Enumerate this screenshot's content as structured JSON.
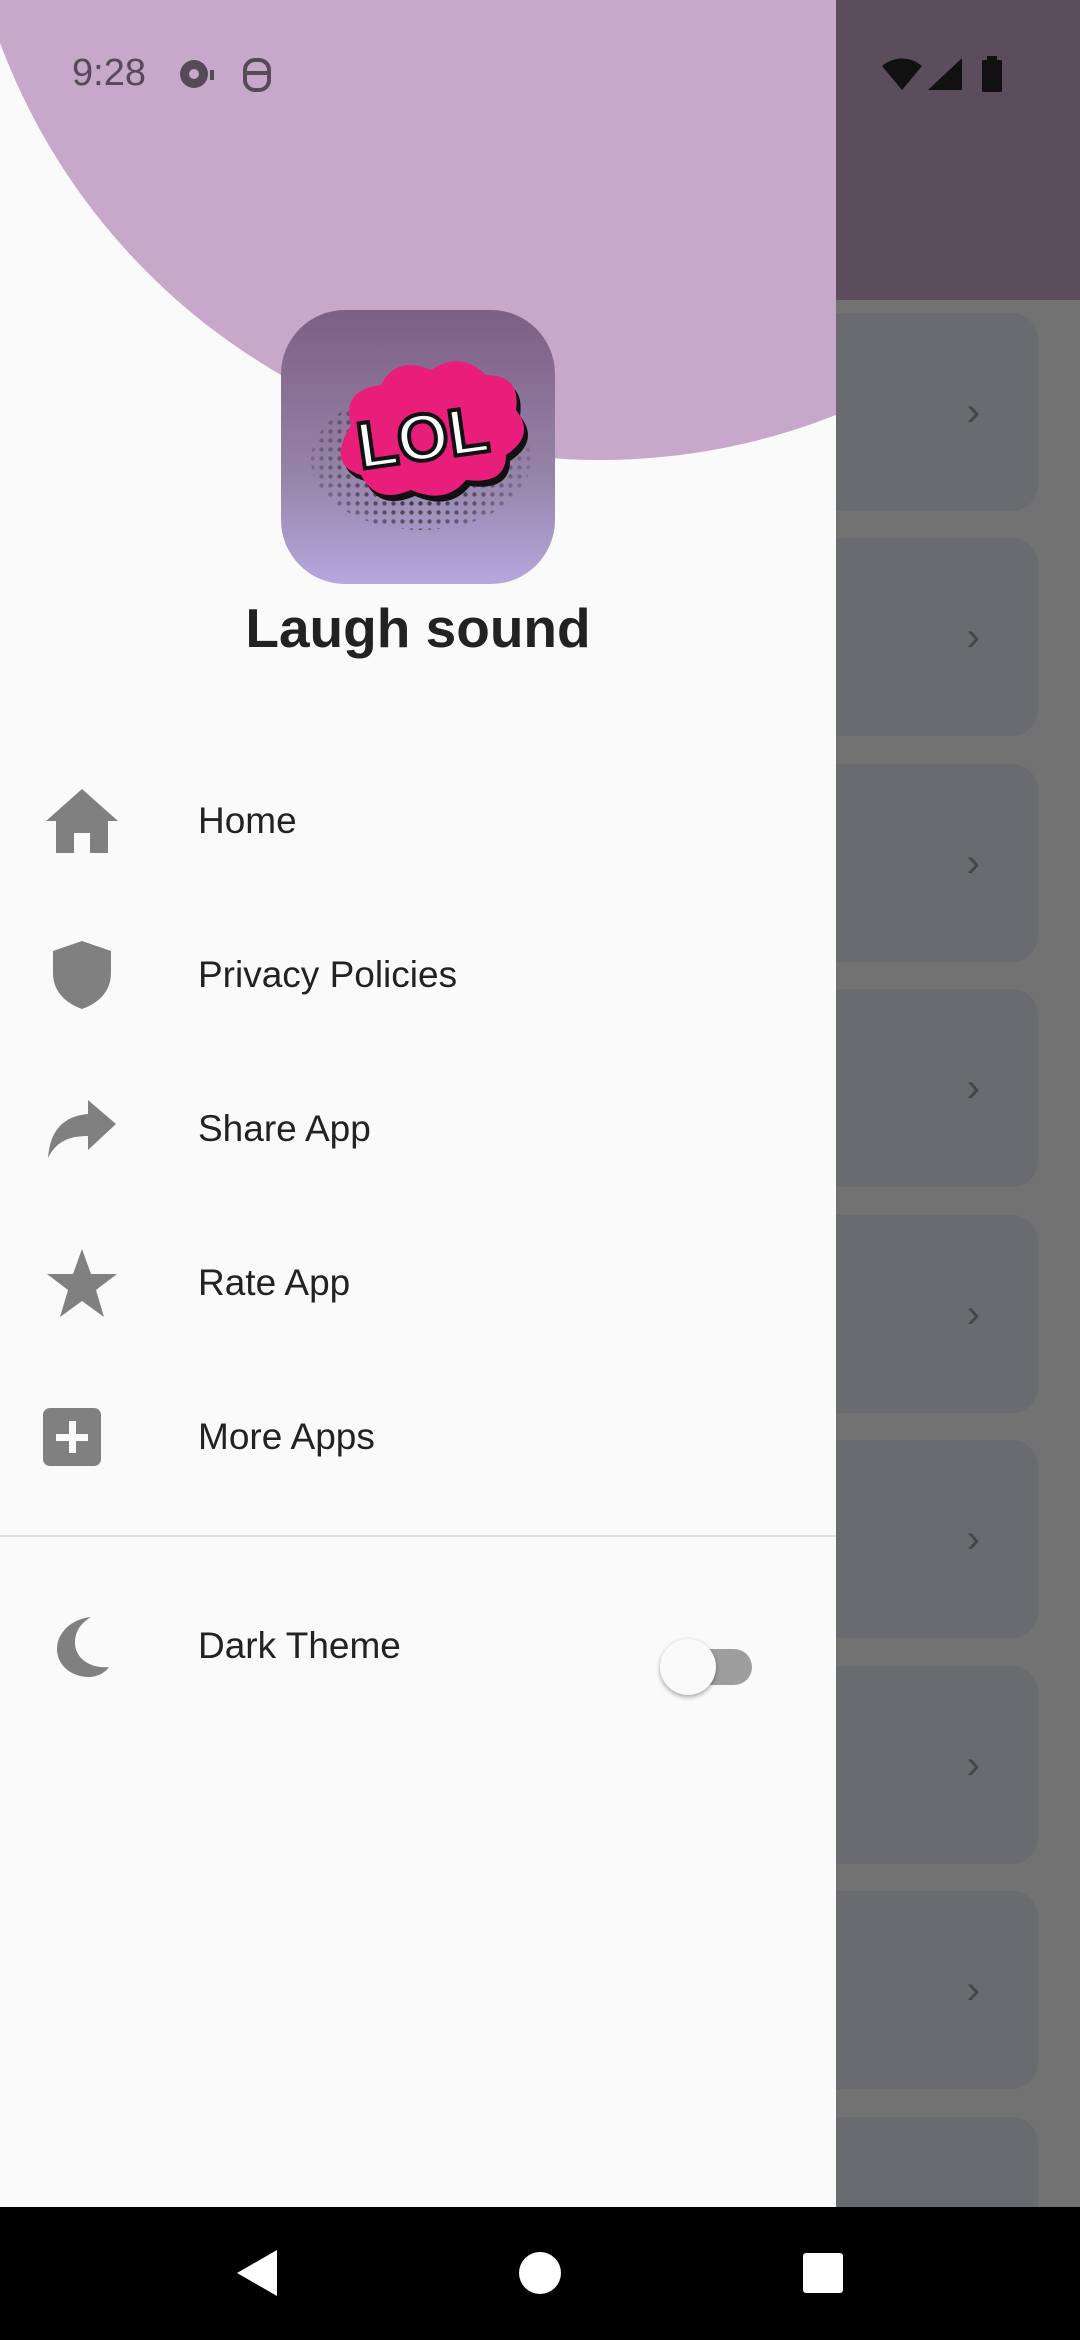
{
  "status_bar": {
    "time": "9:28",
    "left_icons": [
      "media-icon",
      "android-debug-icon"
    ],
    "right_icons": [
      "wifi-icon",
      "signal-icon",
      "battery-icon"
    ]
  },
  "drawer": {
    "app_name": "Laugh sound",
    "logo_text": "LOL",
    "menu": [
      {
        "label": "Home",
        "icon": "home-icon"
      },
      {
        "label": "Privacy Policies",
        "icon": "shield-icon"
      },
      {
        "label": "Share App",
        "icon": "share-icon"
      },
      {
        "label": "Rate App",
        "icon": "star-icon"
      },
      {
        "label": "More Apps",
        "icon": "plus-box-icon"
      }
    ],
    "dark_theme": {
      "label": "Dark Theme",
      "icon": "moon-icon",
      "enabled": false
    }
  },
  "background_list": {
    "item_count": 9,
    "chevron_icon": "chevron-right-icon"
  },
  "nav_bar": {
    "buttons": [
      "back-icon",
      "home-circle-icon",
      "recents-icon"
    ]
  },
  "colors": {
    "accent": "#c7a8cb",
    "drawer_bg": "#fafafa",
    "icon_gray": "#808080",
    "scrim_appbar": "#5c4d5c"
  }
}
